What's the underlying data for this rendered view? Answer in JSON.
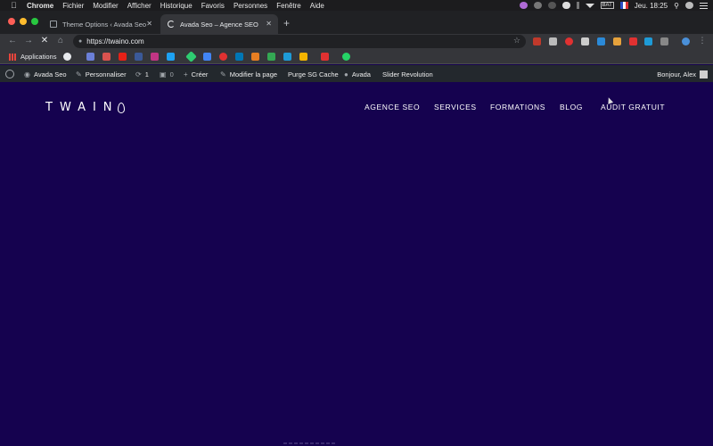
{
  "menubar": {
    "app": "Chrome",
    "items": [
      "Fichier",
      "Modifier",
      "Afficher",
      "Historique",
      "Favoris",
      "Personnes",
      "Fenêtre",
      "Aide"
    ],
    "clock": "Jeu. 18:25",
    "battery": "BAT"
  },
  "tabs": [
    {
      "title": "Theme Options ‹ Avada Seo —",
      "active": false
    },
    {
      "title": "Avada Seo – Agence SEO",
      "active": true
    }
  ],
  "toolbar": {
    "url": "https://twaino.com"
  },
  "bookmarks": {
    "apps_label": "Applications"
  },
  "adminbar": {
    "site_name": "Avada Seo",
    "customize": "Personnaliser",
    "updates": "1",
    "comments": "0",
    "new": "Créer",
    "edit_page": "Modifier la page",
    "purge": "Purge SG Cache",
    "avada": "Avada",
    "slider": "Slider Revolution",
    "greeting": "Bonjour, Alex"
  },
  "site": {
    "logo": "TWAIN",
    "nav": [
      "AGENCE SEO",
      "SERVICES",
      "FORMATIONS",
      "BLOG",
      "AUDIT GRATUIT"
    ]
  },
  "colors": {
    "site_bg": "#15024f",
    "admin_bar": "#23282d",
    "chrome_dark": "#202124",
    "chrome_toolbar": "#35363a"
  }
}
